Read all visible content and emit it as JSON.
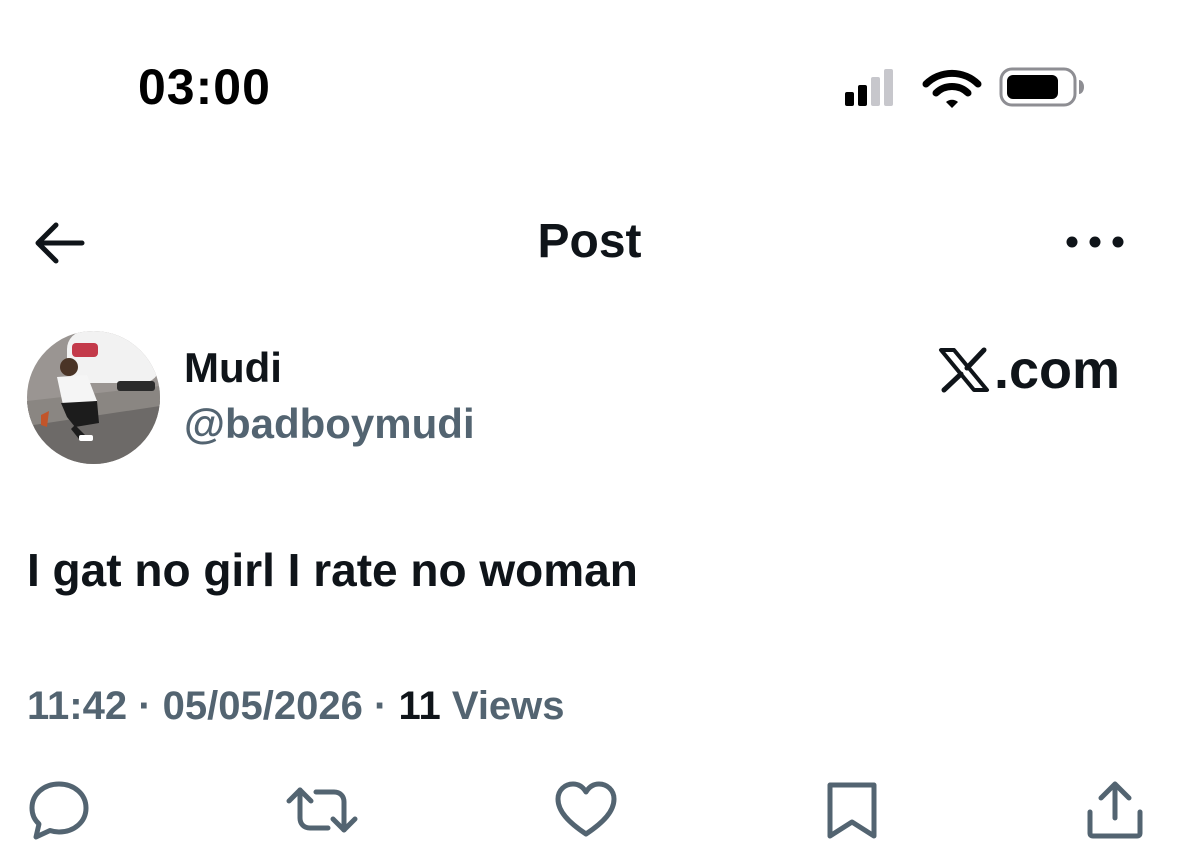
{
  "status_bar": {
    "time": "03:00",
    "signal_icon": "cellular-signal-icon",
    "wifi_icon": "wifi-icon",
    "battery_icon": "battery-icon"
  },
  "header": {
    "title": "Post",
    "back_icon": "arrow-left-icon",
    "more_icon": "more-horizontal-icon"
  },
  "post": {
    "author": {
      "name": "Mudi",
      "handle": "@badboymudi"
    },
    "site_label": "X.com",
    "text": "I gat no girl I rate no woman",
    "time": "11:42",
    "date": "05/05/2026",
    "views_count": "11",
    "views_label": "Views"
  },
  "actions": [
    {
      "name": "reply",
      "icon": "reply-icon"
    },
    {
      "name": "repost",
      "icon": "repost-icon"
    },
    {
      "name": "like",
      "icon": "heart-icon"
    },
    {
      "name": "bookmark",
      "icon": "bookmark-icon"
    },
    {
      "name": "share",
      "icon": "share-icon"
    }
  ],
  "colors": {
    "text_primary": "#0f1419",
    "text_secondary": "#536471",
    "background": "#ffffff"
  }
}
